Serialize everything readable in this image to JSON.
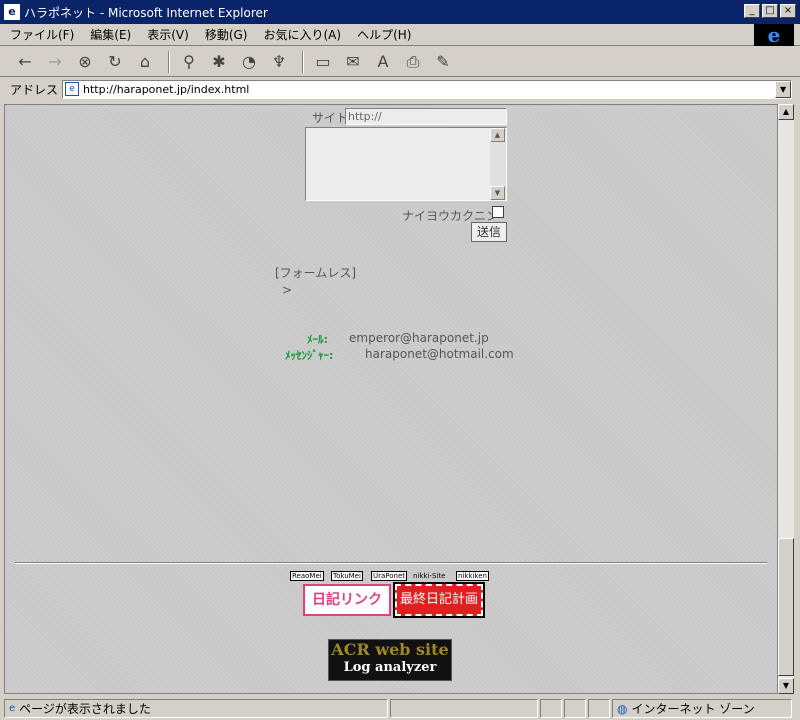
{
  "window": {
    "title": "ハラポネット - Microsoft Internet Explorer",
    "controls": [
      "_",
      "□",
      "×"
    ]
  },
  "menubar": {
    "items": [
      "ファイル(F)",
      "編集(E)",
      "表示(V)",
      "移動(G)",
      "お気に入り(A)",
      "ヘルプ(H)"
    ]
  },
  "toolbar": {
    "back": "←",
    "forward": "→",
    "stop": "⊗",
    "refresh": "↻",
    "home": "⌂",
    "search": "⚲",
    "favorites": "✱",
    "history": "◔",
    "channels": "♆",
    "fullscreen": "▭",
    "mail": "✉",
    "font": "A",
    "print": "⎙",
    "edit": "✎"
  },
  "address": {
    "label": "アドレス",
    "url": "http://haraponet.jp/index.html"
  },
  "form": {
    "site_label": "サイト",
    "url_value": "http://",
    "private_label": "ナイヨウカクニン",
    "submit_label": "送信"
  },
  "formless": {
    "label": "[フォームレス]",
    "arrow": ">"
  },
  "contact": {
    "mail_label": "ﾒｰﾙ:",
    "mail_value": "emperor@haraponet.jp",
    "messenger_label": "ﾒｯｾﾝｼﾞｬｰ:",
    "messenger_value": "haraponet@hotmail.com"
  },
  "banners": {
    "small": [
      "ReaoMei",
      "TokuMei",
      "UraPonet",
      "nikki-Site",
      "nikkiken"
    ],
    "nikki_link": "日記リンク",
    "plan": "最終日記計画",
    "acr_line1": "ACR web site",
    "acr_line2": "Log analyzer"
  },
  "status": {
    "text": "ページが表示されました",
    "zone": "インターネット ゾーン"
  }
}
